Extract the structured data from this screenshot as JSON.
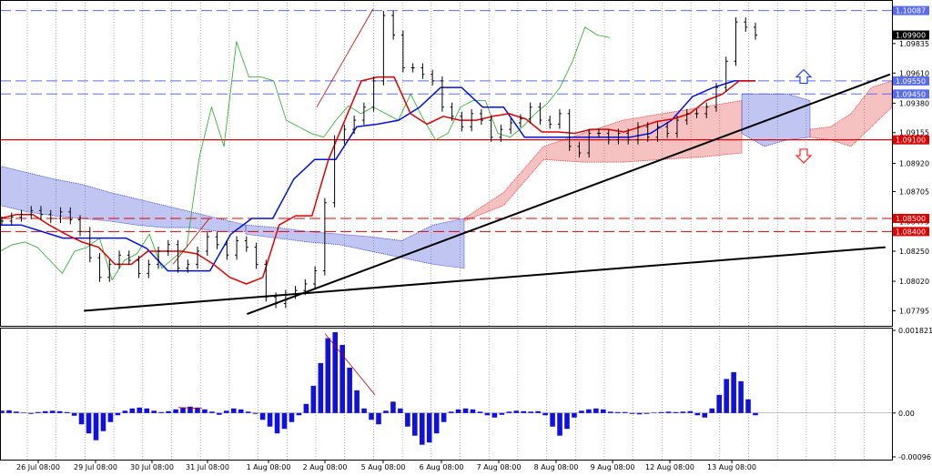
{
  "chart_data": {
    "type": "line",
    "main_panel": {
      "y_range": [
        1.0768,
        1.1014
      ],
      "price_ticks": [
        "1.09835",
        "1.09610",
        "1.09380",
        "1.09155",
        "1.08920",
        "1.08705",
        "1.08475",
        "1.08250",
        "1.08020",
        "1.07795"
      ],
      "horizontal_levels": [
        {
          "value": 1.10087,
          "label": "1.10087",
          "style": "dashed",
          "color": "#5a6cf0"
        },
        {
          "value": 1.0955,
          "label": "1.09550",
          "style": "dashed",
          "color": "#5a6cf0"
        },
        {
          "value": 1.0945,
          "label": "1.09450",
          "style": "dashed",
          "color": "#5a6cf0"
        },
        {
          "value": 1.091,
          "label": "1.09100",
          "style": "solid",
          "color": "#e00000"
        },
        {
          "value": 1.085,
          "label": "1.08500",
          "style": "dashed",
          "color": "#e00000"
        },
        {
          "value": 1.084,
          "label": "1.08400",
          "style": "dashed",
          "color": "#e00000"
        }
      ],
      "current_price": {
        "value": 1.099,
        "label": "1.09900"
      },
      "price_series": [
        1.0848,
        1.0851,
        1.0853,
        1.0856,
        1.0853,
        1.085,
        1.0855,
        1.0849,
        1.084,
        1.082,
        1.0805,
        1.0815,
        1.0822,
        1.0818,
        1.0808,
        1.0815,
        1.0825,
        1.083,
        1.0812,
        1.0815,
        1.0825,
        1.0836,
        1.083,
        1.0822,
        1.0833,
        1.0828,
        1.0815,
        1.079,
        1.0785,
        1.0792,
        1.0795,
        1.08,
        1.081,
        1.0862,
        1.091,
        1.0918,
        1.0925,
        1.0935,
        1.0955,
        1.1005,
        1.099,
        1.0965,
        1.0965,
        1.096,
        1.0955,
        1.0935,
        1.0928,
        1.092,
        1.093,
        1.0925,
        1.0912,
        1.0918,
        1.0923,
        1.0926,
        1.0935,
        1.0925,
        1.0922,
        1.093,
        1.0905,
        1.09,
        1.0915,
        1.0915,
        1.091,
        1.0915,
        1.091,
        1.092,
        1.0912,
        1.092,
        1.0915,
        1.0925,
        1.093,
        1.093,
        1.0935,
        1.095,
        1.097,
        1.1,
        1.0996,
        1.099
      ],
      "tenkan_red": [
        1.085,
        1.0853,
        1.0853,
        1.0845,
        1.0838,
        1.0832,
        1.0828,
        1.0815,
        1.0815,
        1.0825,
        1.0825,
        1.0825,
        1.0823,
        1.0815,
        1.0805,
        1.08,
        1.0805,
        1.0845,
        1.0852,
        1.0852,
        1.0895,
        1.0925,
        1.0955,
        1.0958,
        1.0958,
        1.093,
        1.0922,
        1.0928,
        1.0925,
        1.0925,
        1.0928,
        1.093,
        1.0926,
        1.0916,
        1.0916,
        1.0915,
        1.0918,
        1.0918,
        1.0916,
        1.092,
        1.0924,
        1.0926,
        1.093,
        1.094,
        1.0945,
        1.0955,
        1.0955
      ],
      "kijun_blue": [
        1.0845,
        1.0845,
        1.084,
        1.0835,
        1.0835,
        1.0835,
        1.0835,
        1.0827,
        1.081,
        1.081,
        1.081,
        1.0838,
        1.085,
        1.085,
        1.088,
        1.0895,
        1.0895,
        1.092,
        1.0922,
        1.0925,
        1.0935,
        1.095,
        1.095,
        1.0935,
        1.0935,
        1.0912,
        1.0912,
        1.0912,
        1.0912,
        1.0912,
        1.0912,
        1.0915,
        1.0925,
        1.0943,
        1.095,
        1.0955,
        1.0955
      ],
      "chikou_green": [
        1.0825,
        1.083,
        1.0832,
        1.0828,
        1.0818,
        1.0808,
        1.0825,
        1.0828,
        1.0835,
        1.0803,
        1.0818,
        1.0823,
        1.0838,
        1.0812,
        1.082,
        1.0828,
        1.0896,
        1.0935,
        1.0905,
        1.0985,
        1.0958,
        1.0958,
        1.0955,
        1.0925,
        1.092,
        1.0915,
        1.0912,
        1.0925,
        1.0936,
        1.093,
        1.0935,
        1.093,
        1.0925,
        1.0945,
        1.0926,
        1.091,
        1.0915,
        1.0935,
        1.094,
        1.094,
        1.0915,
        1.0912,
        1.092,
        1.093,
        1.0938,
        1.095,
        1.097,
        1.0996,
        1.099,
        1.0988
      ],
      "trendlines": [
        {
          "points": [
            [
              0.09,
              1.07795
            ],
            [
              0.95,
              1.0828
            ]
          ],
          "color": "#000"
        },
        {
          "points": [
            [
              0.265,
              1.0777
            ],
            [
              0.955,
              1.096
            ]
          ],
          "color": "#000"
        }
      ]
    },
    "oscillator_panel": {
      "ticks": [
        "0.0018211",
        "0.00",
        "-0.0009676"
      ],
      "y_range": [
        -0.0009676,
        0.0018211
      ],
      "histogram": [
        5e-05,
        6e-05,
        3e-05,
        1e-05,
        -2e-05,
        2e-05,
        4e-05,
        5e-05,
        4e-05,
        2e-05,
        -6e-05,
        -0.00025,
        -0.00045,
        -0.0006,
        -0.0004,
        -0.0002,
        -5e-05,
        5e-05,
        0.0001,
        0.00012,
        0.0001,
        5e-05,
        2e-05,
        4e-05,
        8e-05,
        0.00012,
        0.00014,
        0.00012,
        8e-05,
        3e-05,
        -4e-05,
        5e-05,
        0.0001,
        8e-05,
        3e-05,
        -2e-05,
        -0.00015,
        -0.0003,
        -0.00045,
        -0.00035,
        -0.0002,
        -5e-05,
        0.0002,
        0.0006,
        0.0011,
        0.00165,
        0.00178,
        0.0015,
        0.001,
        0.0005,
        0.0001,
        -0.00015,
        -0.00025,
        5e-05,
        0.00025,
        0.0001,
        -0.0003,
        -0.0005,
        -0.0007,
        -0.00065,
        -0.00045,
        -0.0002,
        3e-05,
        8e-05,
        0.0001,
        8e-05,
        3e-05,
        -5e-05,
        -0.0001,
        -4e-05,
        3e-05,
        5e-05,
        4e-05,
        3e-05,
        4e-05,
        -5e-05,
        -0.0003,
        -0.0005,
        -0.00035,
        -0.0001,
        5e-05,
        8e-05,
        0.0001,
        8e-05,
        3e-05,
        2e-05,
        2e-05,
        -2e-05,
        -3e-05,
        -2e-05,
        1e-05,
        2e-05,
        3e-05,
        2e-05,
        3e-05,
        4e-05,
        -5e-05,
        -0.0001,
        0.0001,
        0.0004,
        0.00075,
        0.0009,
        0.0007,
        0.0003,
        -5e-05
      ]
    },
    "x_axis": {
      "labels": [
        "26 Jul 08:00",
        "29 Jul 08:00",
        "30 Jul 08:00",
        "31 Jul 08:00",
        "1 Aug 08:00",
        "2 Aug 08:00",
        "5 Aug 08:00",
        "6 Aug 08:00",
        "7 Aug 08:00",
        "8 Aug 08:00",
        "9 Aug 08:00",
        "12 Aug 08:00",
        "13 Aug 08:00"
      ],
      "grid": true
    },
    "colors": {
      "price": "#000000",
      "tenkan": "#e00000",
      "kijun": "#0010e0",
      "chikou": "#22aa22",
      "cloud_bear": "#2030d0",
      "cloud_bull": "#e02020",
      "oscillator": "#1010e0",
      "up_arrow": "#2040ff",
      "down_arrow": "#ff2020"
    },
    "signals": {
      "up_arrow": "up-arrow-icon",
      "down_arrow": "down-arrow-icon"
    }
  }
}
